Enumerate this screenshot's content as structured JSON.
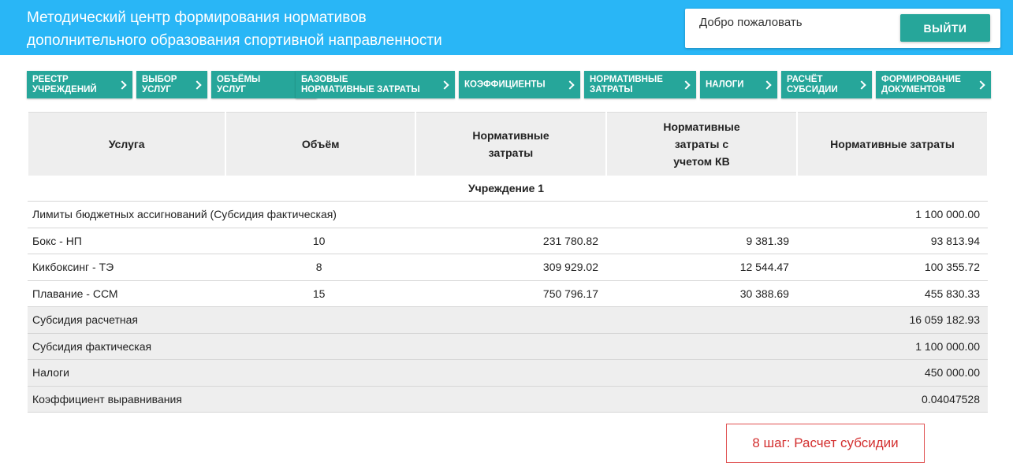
{
  "header": {
    "title_line1": "Методический центр формирования нормативов",
    "title_line2": "дополнительного образования спортивной направленности",
    "welcome": "Добро пожаловать",
    "logout_label": "ВЫЙТИ"
  },
  "steps": [
    {
      "label": "РЕЕСТР\nУЧРЕЖДЕНИЙ"
    },
    {
      "label": "ВЫБОР\nУСЛУГ"
    },
    {
      "label": "ОБЪЁМЫ\nУСЛУГ"
    },
    {
      "label": "БАЗОВЫЕ\nНОРМАТИВНЫЕ ЗАТРАТЫ"
    },
    {
      "label": "КОЭФФИЦИЕНТЫ"
    },
    {
      "label": "НОРМАТИВНЫЕ\nЗАТРАТЫ"
    },
    {
      "label": "НАЛОГИ"
    },
    {
      "label": "РАСЧЁТ\nСУБСИДИИ"
    },
    {
      "label": "ФОРМИРОВАНИЕ\nДОКУМЕНТОВ"
    }
  ],
  "table": {
    "headers": [
      "Услуга",
      "Объём",
      "Нормативные\nзатраты",
      "Нормативные\nзатраты с\nучетом КВ",
      "Нормативные затраты"
    ],
    "group": "Учреждение 1",
    "limit_label": "Лимиты бюджетных ассигнований (Субсидия фактическая)",
    "limit_value": "1 100 000.00",
    "rows": [
      {
        "service": "Бокс - НП",
        "volume": "10",
        "norm": "231 780.82",
        "norm_kv": "9 381.39",
        "total": "93 813.94"
      },
      {
        "service": "Кикбоксинг - ТЭ",
        "volume": "8",
        "norm": "309 929.02",
        "norm_kv": "12 544.47",
        "total": "100 355.72"
      },
      {
        "service": "Плавание - ССМ",
        "volume": "15",
        "norm": "750 796.17",
        "norm_kv": "30 388.69",
        "total": "455 830.33"
      }
    ],
    "summary": [
      {
        "label": "Субсидия расчетная",
        "value": "16 059 182.93"
      },
      {
        "label": "Субсидия фактическая",
        "value": "1 100 000.00"
      },
      {
        "label": "Налоги",
        "value": "450 000.00"
      },
      {
        "label": "Коэффициент выравнивания",
        "value": "0.04047528"
      }
    ]
  },
  "note": "8 шаг: Расчет субсидии"
}
